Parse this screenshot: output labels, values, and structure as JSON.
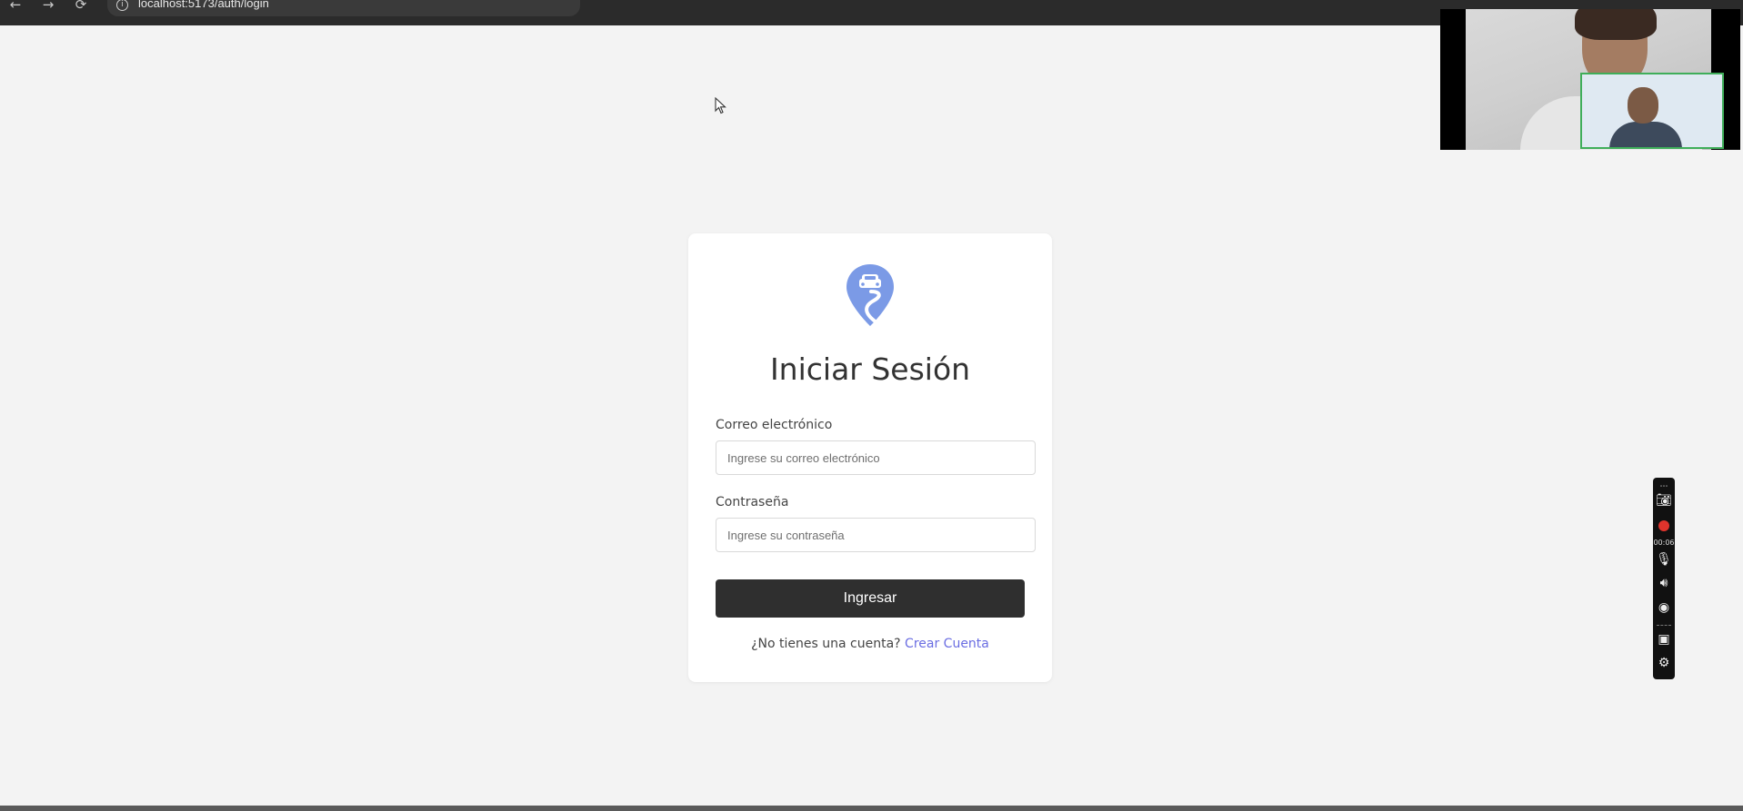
{
  "browser": {
    "back_glyph": "←",
    "forward_glyph": "→",
    "reload_glyph": "⟳",
    "info_glyph": "i",
    "url": "localhost:5173/auth/login"
  },
  "login": {
    "title": "Iniciar Sesión",
    "email_label": "Correo electrónico",
    "email_placeholder": "Ingrese su correo electrónico",
    "email_value": "",
    "password_label": "Contraseña",
    "password_placeholder": "Ingrese su contraseña",
    "password_value": "",
    "submit_label": "Ingresar",
    "signup_prompt": "¿No tienes una cuenta?",
    "signup_link": "Crear Cuenta",
    "logo_icon": "car-location-pin-icon",
    "accent_color": "#7b9ae6",
    "link_color": "#6a6de2",
    "button_color": "#2f2f2f"
  },
  "recorder": {
    "timer": "00:06",
    "icons": [
      "camera-icon",
      "record-icon",
      "microphone-icon",
      "speaker-icon",
      "webcam-icon",
      "window-icon",
      "settings-icon"
    ]
  },
  "video_call": {
    "main_participant": "participant-video",
    "pip_participant": "self-video"
  }
}
